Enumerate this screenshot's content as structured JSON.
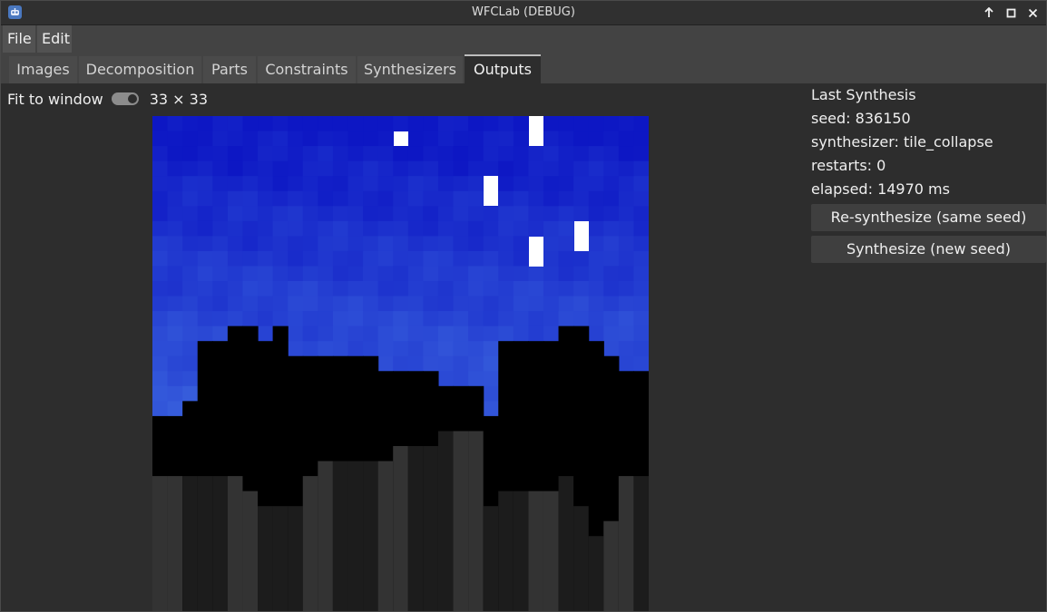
{
  "window": {
    "title": "WFCLab (DEBUG)",
    "controls": [
      "arrow-up-icon",
      "maximize-icon",
      "close-icon"
    ]
  },
  "menu": {
    "items": [
      {
        "label": "File"
      },
      {
        "label": "Edit"
      }
    ]
  },
  "tabs": {
    "items": [
      {
        "label": "Images"
      },
      {
        "label": "Decomposition"
      },
      {
        "label": "Parts"
      },
      {
        "label": "Constraints"
      },
      {
        "label": "Synthesizers"
      },
      {
        "label": "Outputs"
      }
    ],
    "active": "Outputs"
  },
  "view": {
    "fit_label": "Fit to window",
    "fit_enabled": true,
    "size_label": "33 × 33"
  },
  "last_synthesis": {
    "heading": "Last Synthesis",
    "seed": "seed: 836150",
    "synthesizer": "synthesizer: tile_collapse",
    "restarts": "restarts: 0",
    "elapsed": "elapsed: 14970 ms",
    "resynth_label": "Re-synthesize (same seed)",
    "synth_new_label": "Synthesize (new seed)"
  },
  "colors": {
    "window_bg": "#2d2d2d",
    "menubar_bg": "#434343",
    "button_bg": "#3f3f3f",
    "sky_dark": "#0d17c4",
    "sky_light": "#4271e2",
    "star": "#ffffff",
    "ground_black": "#000000",
    "ground_dark": "#1c1c1c",
    "ground_mid": "#333333"
  }
}
